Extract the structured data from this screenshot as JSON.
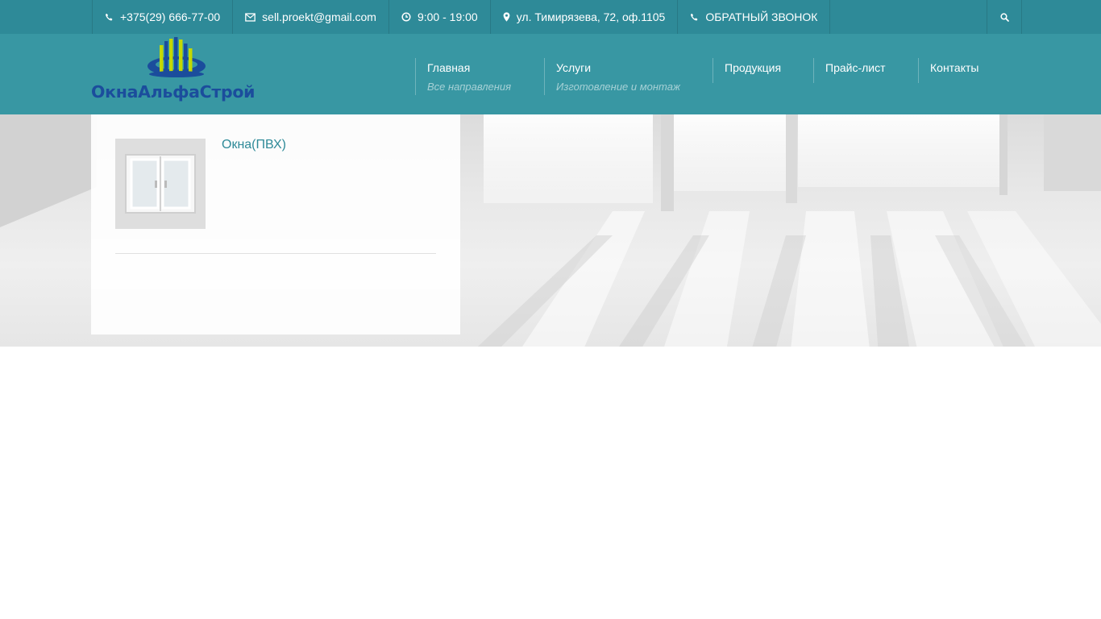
{
  "topbar": {
    "phone": "+375(29) 666-77-00",
    "email": "sell.proekt@gmail.com",
    "hours": "9:00 - 19:00",
    "address": "ул. Тимирязева, 72, оф.1105",
    "callback": "ОБРАТНЫЙ ЗВОНОК",
    "icons": [
      "phone-icon",
      "envelope-icon",
      "clock-icon",
      "map-marker-icon",
      "phone-icon",
      "search-icon"
    ]
  },
  "header": {
    "logo_text": "ОкнаАльфаСтрой",
    "nav": [
      {
        "title": "Главная",
        "subtitle": "Все направления"
      },
      {
        "title": "Услуги",
        "subtitle": "Изготовление и монтаж"
      },
      {
        "title": "Продукция",
        "subtitle": ""
      },
      {
        "title": "Прайс-лист",
        "subtitle": ""
      },
      {
        "title": "Контакты",
        "subtitle": ""
      }
    ]
  },
  "content": {
    "items": [
      {
        "title": "Окна(ПВХ)"
      }
    ]
  },
  "colors": {
    "topbar": "#2e8a98",
    "header": "#3897a3",
    "accent": "#2e8a98",
    "logo_blue": "#1b4d9c",
    "logo_green": "#c4d800"
  }
}
